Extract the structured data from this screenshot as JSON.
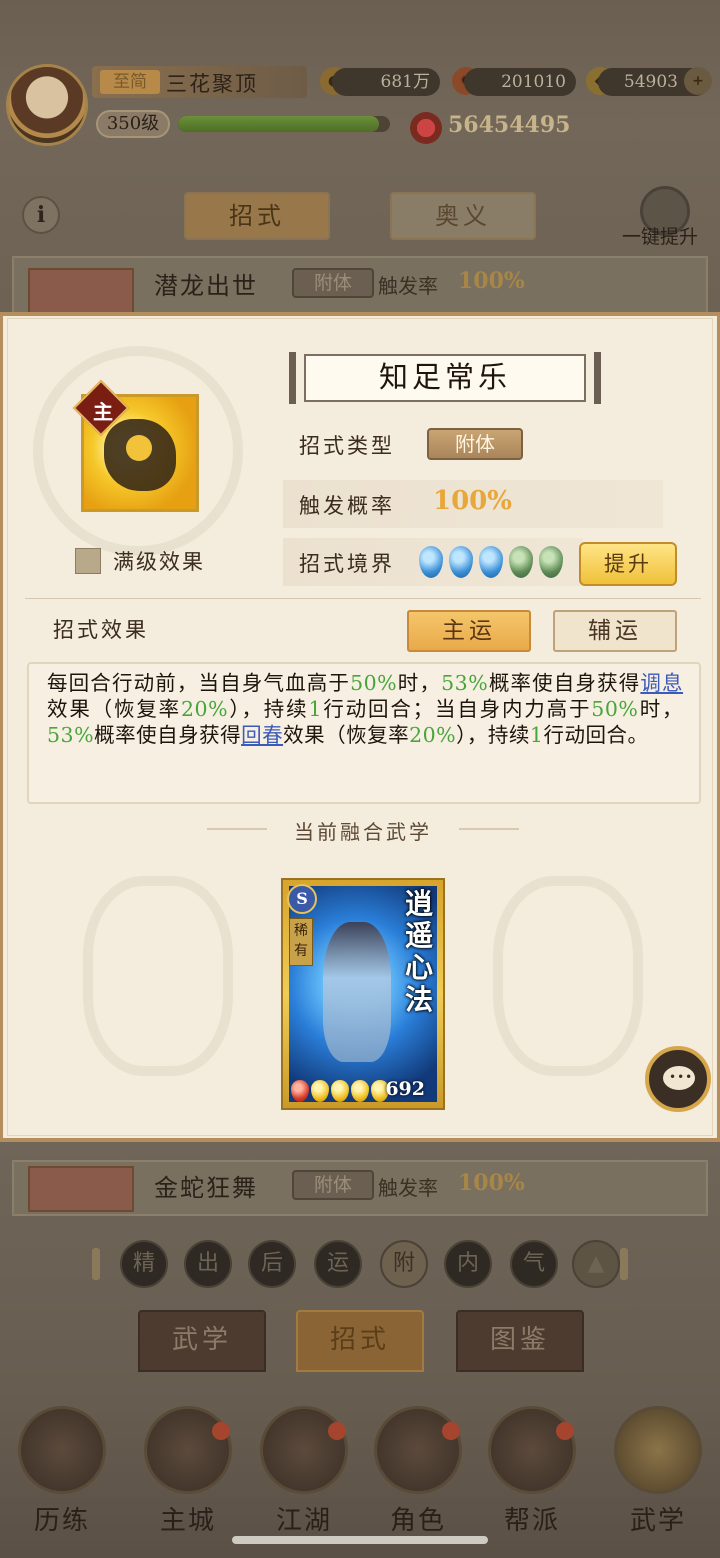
{
  "header": {
    "rank_title": "至简",
    "player_name": "三花聚顶",
    "level": "350级",
    "exp_fraction": 0.95,
    "coins": "681万",
    "currency2": "201010",
    "gold": "54903",
    "power": "56454495"
  },
  "tabs": {
    "moves": "招式",
    "secrets": "奥义",
    "one_key_upgrade": "一键提升"
  },
  "list": [
    {
      "name": "潜龙出世",
      "tag": "附体",
      "rate_label": "触发率",
      "rate": "100%"
    },
    {
      "name": "金蛇狂舞",
      "tag": "附体",
      "rate_label": "触发率",
      "rate": "100%"
    }
  ],
  "modal": {
    "title": "知足常乐",
    "main_tag": "主",
    "max_level_label": "满级效果",
    "type_label": "招式类型",
    "type_value": "附体",
    "rate_label": "触发概率",
    "rate_value": "100%",
    "realm_label": "招式境界",
    "realm_drops": [
      "blue",
      "blue",
      "blue",
      "green",
      "green"
    ],
    "upgrade_label": "提升",
    "effect_label": "招式效果",
    "main_luck": "主运",
    "aux_luck": "辅运",
    "desc": {
      "p1": "每回合行动前，当自身气血高于",
      "v1": "50%",
      "p2": "时，",
      "v2": "53%",
      "p3": "概率使自身获得",
      "k1": "调息",
      "p4": "效果（恢复率",
      "v3": "20%",
      "p5": "），持续",
      "v4": "1",
      "p6": "行动回合；当自身内力高于",
      "v5": "50%",
      "p7": "时，",
      "v6": "53%",
      "p8": "概率使自身获得",
      "k2": "回春",
      "p9": "效果（恢复率",
      "v7": "20%",
      "p10": "），持续",
      "v8": "1",
      "p11": "行动回合。"
    },
    "fusion_title": "当前融合武学",
    "card": {
      "name": "逍遥心法",
      "grade": "S",
      "rarity": "稀有",
      "value": "692"
    }
  },
  "filters": [
    "精",
    "出",
    "后",
    "运",
    "附",
    "内",
    "气"
  ],
  "sub_tabs": [
    "武学",
    "招式",
    "图鉴"
  ],
  "nav": [
    "历练",
    "主城",
    "江湖",
    "角色",
    "帮派",
    "武学"
  ],
  "colors": {
    "accent_gold": "#f0c13a",
    "green_value": "#48a53c",
    "blue_keyword": "#3c5ab8"
  }
}
